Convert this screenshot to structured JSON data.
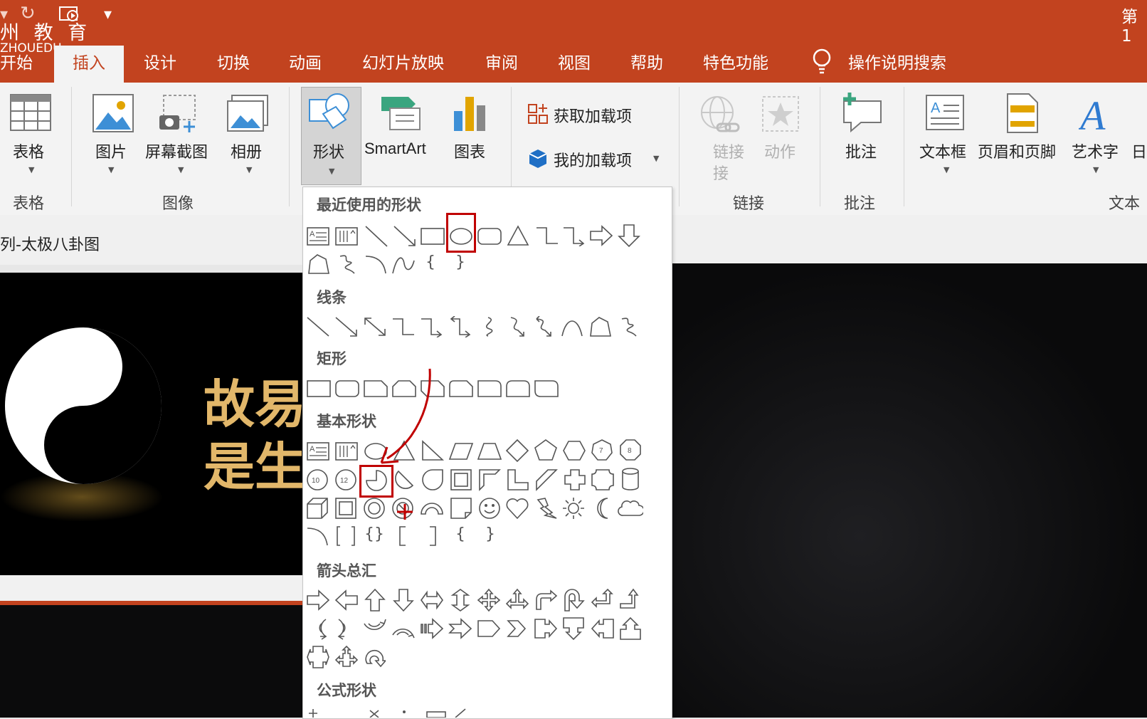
{
  "window": {
    "title_fragment": "第1"
  },
  "watermark": {
    "cn": "州 教 育",
    "en": "ZHOUEDU"
  },
  "tabs": [
    {
      "label": "开始",
      "active": false
    },
    {
      "label": "插入",
      "active": true
    },
    {
      "label": "设计",
      "active": false
    },
    {
      "label": "切换",
      "active": false
    },
    {
      "label": "动画",
      "active": false
    },
    {
      "label": "幻灯片放映",
      "active": false
    },
    {
      "label": "审阅",
      "active": false
    },
    {
      "label": "视图",
      "active": false
    },
    {
      "label": "帮助",
      "active": false
    },
    {
      "label": "特色功能",
      "active": false
    }
  ],
  "search": {
    "label": "操作说明搜索",
    "icon": "lightbulb-icon"
  },
  "ribbon": {
    "table": {
      "label": "表格",
      "group": "表格"
    },
    "picture": {
      "label": "图片"
    },
    "screenshot": {
      "label": "屏幕截图"
    },
    "album": {
      "label": "相册"
    },
    "images_group": "图像",
    "shapes": {
      "label": "形状"
    },
    "smartart": {
      "label": "SmartArt"
    },
    "chart": {
      "label": "图表"
    },
    "get_addins": {
      "label": "获取加载项"
    },
    "my_addins": {
      "label": "我的加载项"
    },
    "link": {
      "label": "链接"
    },
    "link_sub": "接",
    "action": {
      "label": "动作"
    },
    "links_group": "链接",
    "comment": {
      "label": "批注",
      "group": "批注"
    },
    "textbox": {
      "label": "文本框"
    },
    "header_footer": {
      "label": "页眉和页脚"
    },
    "wordart": {
      "label": "艺术字"
    },
    "date_fragment": "日",
    "text_group_fragment": "文本"
  },
  "document": {
    "title_fragment": "列-太极八卦图"
  },
  "slide": {
    "line1_fragment": "故易",
    "line2_fragment": "是生"
  },
  "shapes_gallery": {
    "categories": [
      "最近使用的形状",
      "线条",
      "矩形",
      "基本形状",
      "箭头总汇",
      "公式形状"
    ]
  },
  "colors": {
    "accent": "#c2431f",
    "highlight": "#c00000",
    "gold": "#e2b76a"
  }
}
